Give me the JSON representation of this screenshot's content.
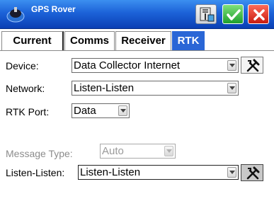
{
  "titlebar": {
    "title": "GPS Rover",
    "icons": {
      "app": "gps-satellite-icon",
      "tool": "survey-tool-icon",
      "ok": "checkmark-icon",
      "close": "close-x-icon"
    },
    "colors": {
      "bar": "#1c62d8",
      "ok": "#1e9f2c",
      "close": "#c81c10"
    }
  },
  "tabs": [
    {
      "label": "Current",
      "active": false
    },
    {
      "label": "Comms",
      "active": false
    },
    {
      "label": "Receiver",
      "active": false
    },
    {
      "label": "RTK",
      "active": true
    }
  ],
  "form": {
    "device": {
      "label": "Device:",
      "value": "Data Collector Internet",
      "action_icon": "hammer-wrench-icon"
    },
    "network": {
      "label": "Network:",
      "value": "Listen-Listen"
    },
    "rtk_port": {
      "label": "RTK Port:",
      "value": "Data"
    },
    "message_type": {
      "label": "Message Type:",
      "value": "Auto",
      "enabled": false
    },
    "listen_listen": {
      "label": "Listen-Listen:",
      "value": "Listen-Listen",
      "action_icon": "hammer-wrench-icon"
    }
  },
  "colors": {
    "active_tab": "#2a66d6"
  }
}
